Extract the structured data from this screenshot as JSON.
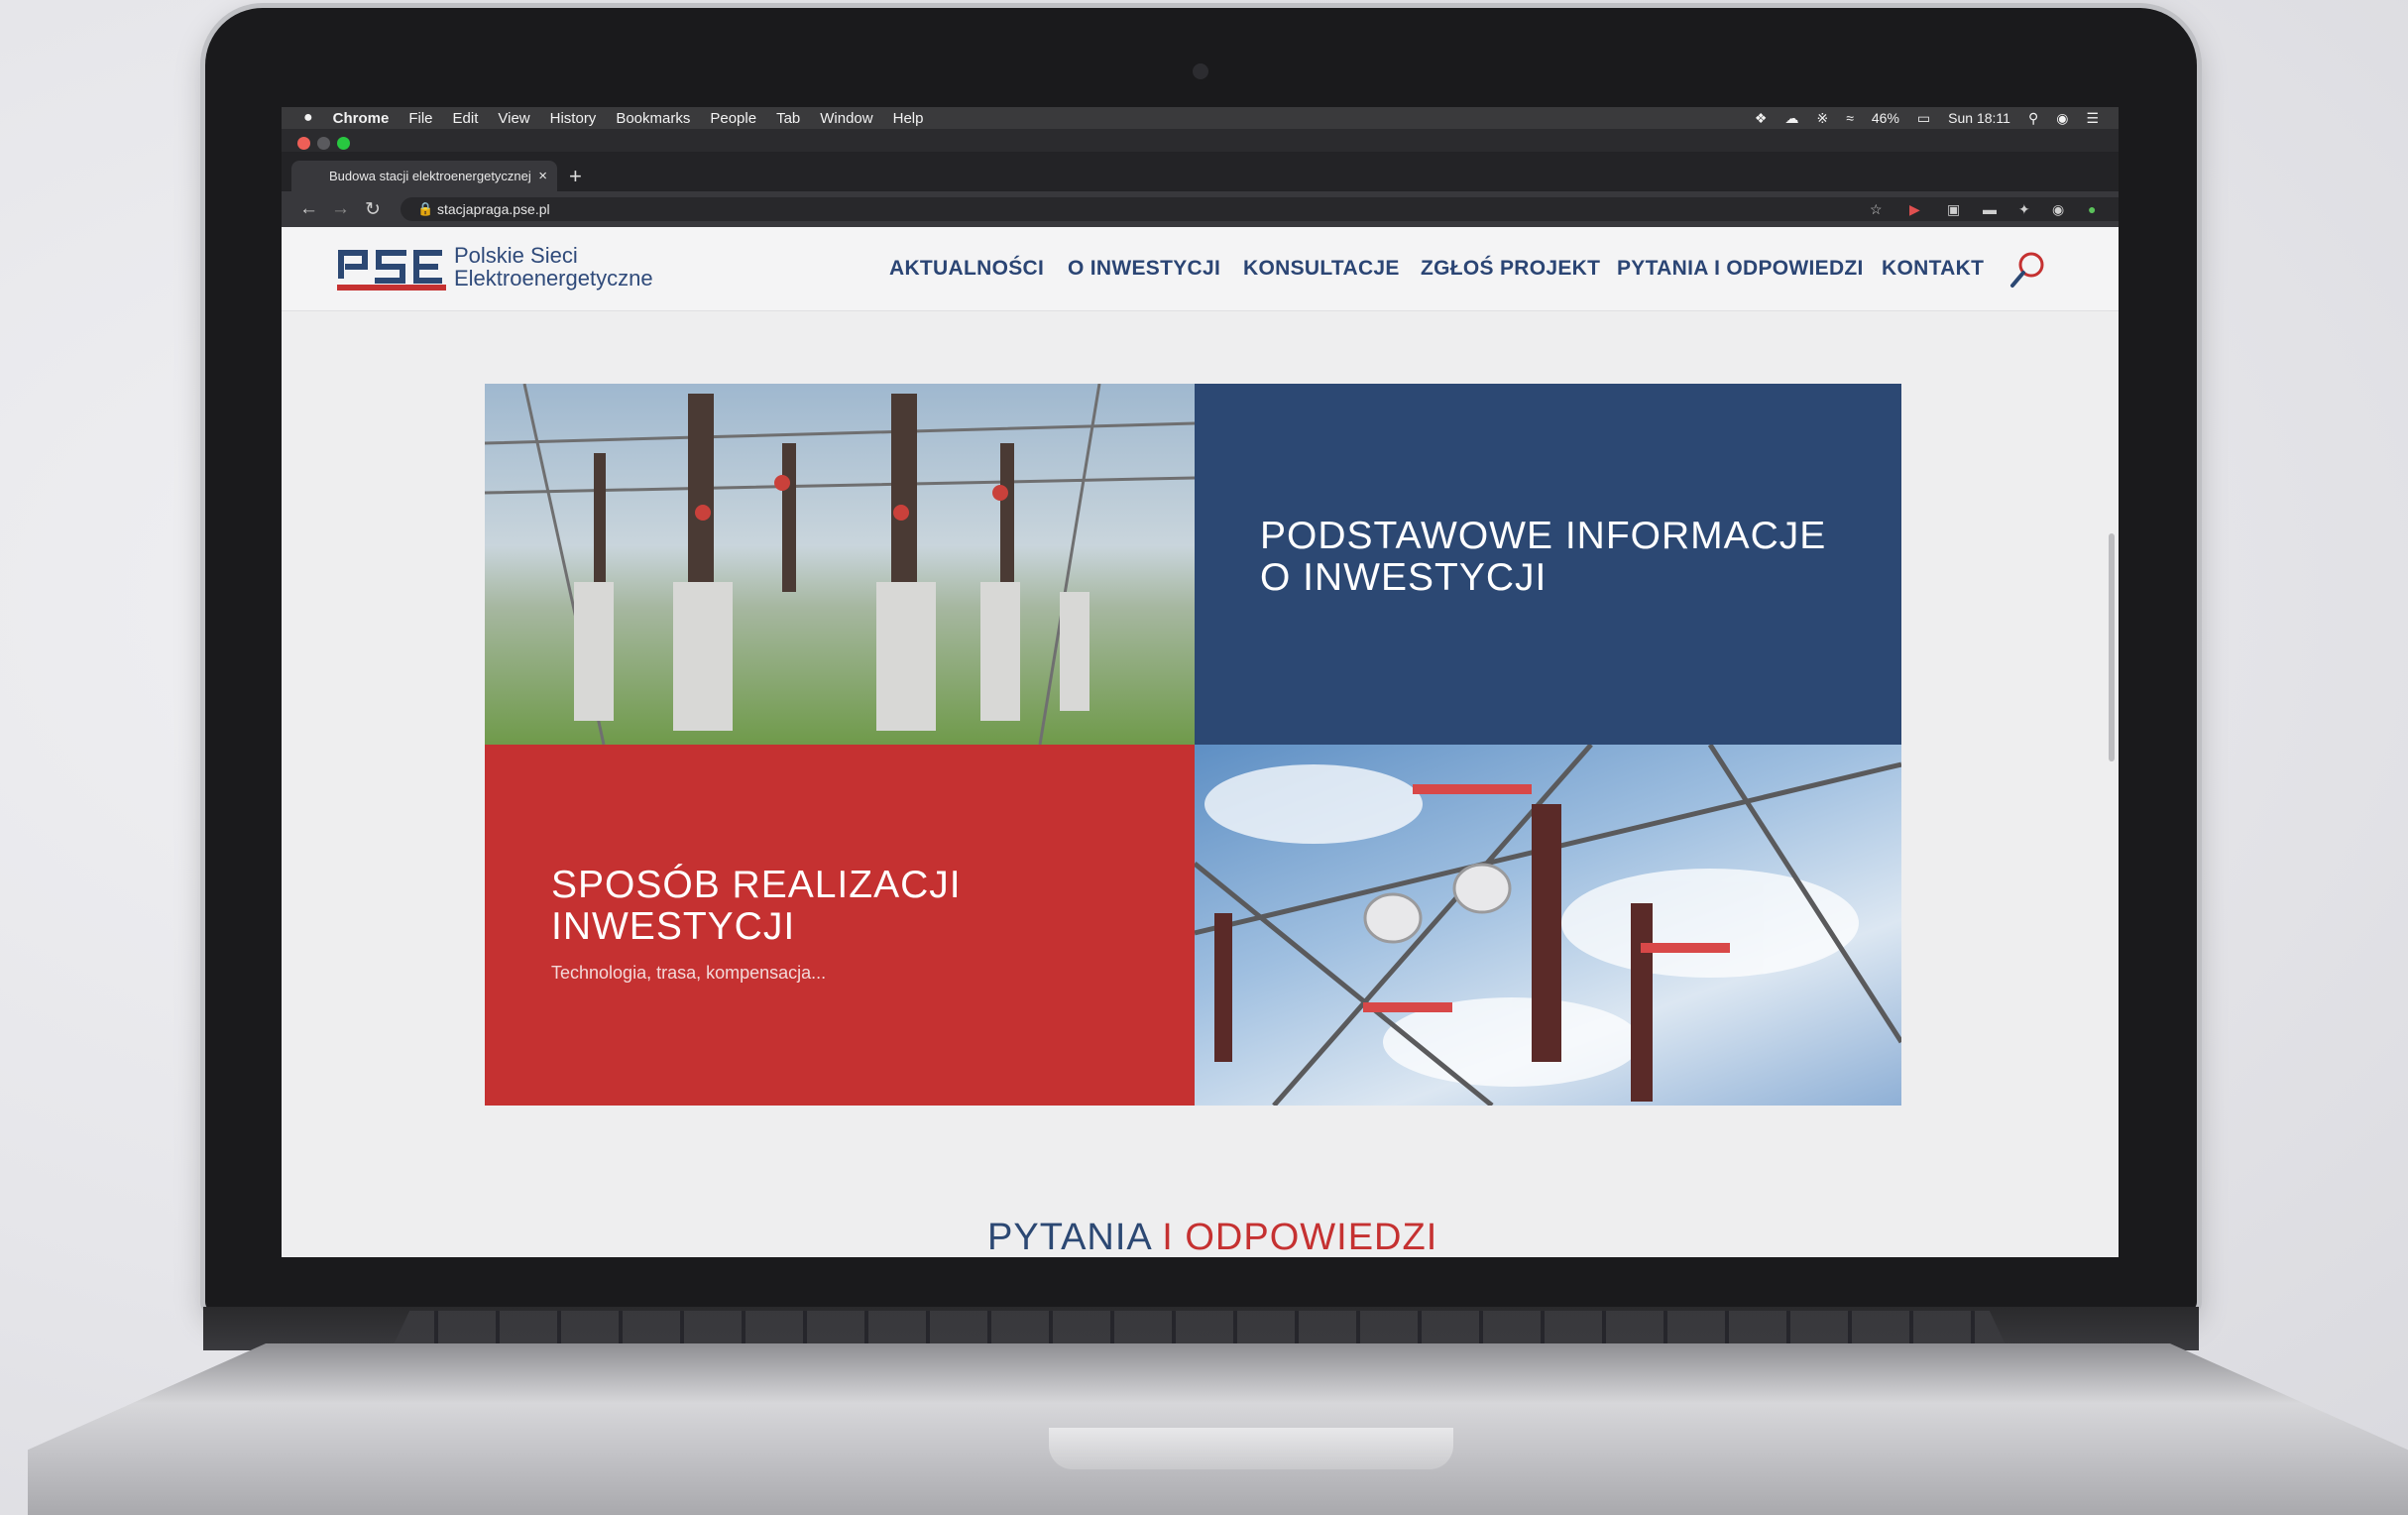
{
  "menubar": {
    "app": "Chrome",
    "items": [
      "File",
      "Edit",
      "View",
      "History",
      "Bookmarks",
      "People",
      "Tab",
      "Window",
      "Help"
    ],
    "battery": "46%",
    "clock": "Sun 18:11"
  },
  "browser": {
    "tab_title": "Budowa stacji elektroenergetycznej",
    "url": "stacjapraga.pse.pl"
  },
  "site": {
    "logo_letters": "PSE",
    "logo_line1": "Polskie Sieci",
    "logo_line2": "Elektroenergetyczne",
    "nav": [
      "AKTUALNOŚCI",
      "O INWESTYCJI",
      "KONSULTACJE",
      "ZGŁOŚ PROJEKT",
      "PYTANIA I ODPOWIEDZI",
      "KONTAKT"
    ],
    "tiles": {
      "blue_line1": "PODSTAWOWE INFORMACJE",
      "blue_line2": "O INWESTYCJI",
      "red_line1": "SPOSÓB REALIZACJI",
      "red_line2": "INWESTYCJI",
      "red_sub": "Technologia, trasa, kompensacja..."
    },
    "section_title_a": "PYTANIA",
    "section_title_b": " I ODPOWIEDZI"
  },
  "colors": {
    "brand_blue": "#2c4873",
    "brand_red": "#c53131"
  },
  "icons": [
    "apple-icon",
    "dropbox-icon",
    "bluetooth-icon",
    "wifi-icon",
    "battery-icon",
    "search-icon",
    "siri-icon",
    "list-icon",
    "back-icon",
    "forward-icon",
    "reload-icon",
    "lock-icon",
    "star-icon",
    "extension-icon",
    "profile-icon",
    "magnifier-icon"
  ]
}
